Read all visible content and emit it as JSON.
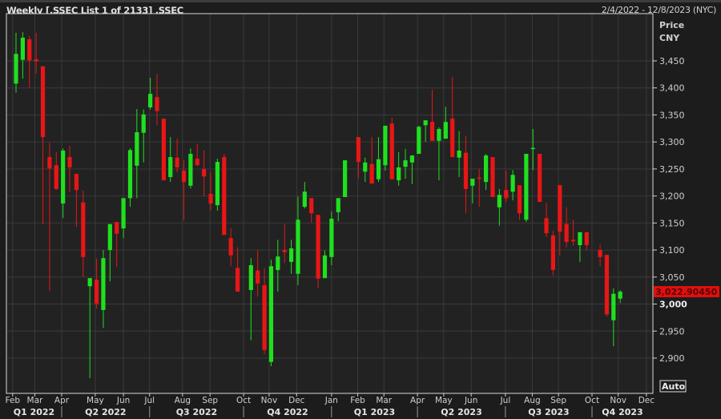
{
  "header": {
    "title": "Weekly [.SSEC List 1 of 2133] .SSEC",
    "range": "2/4/2022 - 12/8/2023 (NYC)"
  },
  "axis": {
    "unit_line1": "Price",
    "unit_line2": "CNY",
    "auto_label": "Auto",
    "last_price_label": "3,022.90450"
  },
  "colors": {
    "up": "#1fe01f",
    "down": "#e81616",
    "grid": "#3a3a3a",
    "plot_bg": "#222222",
    "last_price_bg": "#e01010"
  },
  "chart_data": {
    "type": "candlestick",
    "title": "Weekly .SSEC",
    "ylabel": "Price CNY",
    "ylim": [
      2880,
      3510
    ],
    "xlim": [
      -1.5,
      95
    ],
    "last_price": 3022.9045,
    "yticks": [
      2900,
      2950,
      3000,
      3050,
      3100,
      3150,
      3200,
      3250,
      3300,
      3350,
      3400,
      3450
    ],
    "ytick_labels": [
      "2,900",
      "2,950",
      "3,000",
      "3,050",
      "3,100",
      "3,150",
      "3,200",
      "3,250",
      "3,300",
      "3,350",
      "3,400",
      "3,450"
    ],
    "months": [
      {
        "label": "Feb",
        "w": -0.5
      },
      {
        "label": "Mar",
        "w": 2.8
      },
      {
        "label": "Apr",
        "w": 6.8
      },
      {
        "label": "May",
        "w": 11.8
      },
      {
        "label": "Jun",
        "w": 16
      },
      {
        "label": "Jul",
        "w": 19.9
      },
      {
        "label": "Aug",
        "w": 24.8
      },
      {
        "label": "Sep",
        "w": 28.9
      },
      {
        "label": "Oct",
        "w": 33.9
      },
      {
        "label": "Nov",
        "w": 37.7
      },
      {
        "label": "Dec",
        "w": 41.8
      },
      {
        "label": "Jan",
        "w": 47
      },
      {
        "label": "Feb",
        "w": 50.9
      },
      {
        "label": "Mar",
        "w": 54.8
      },
      {
        "label": "Apr",
        "w": 59.8
      },
      {
        "label": "May",
        "w": 63.7
      },
      {
        "label": "Jun",
        "w": 67.8
      },
      {
        "label": "Jul",
        "w": 72.9
      },
      {
        "label": "Aug",
        "w": 76.9
      },
      {
        "label": "Sep",
        "w": 80.8
      },
      {
        "label": "Oct",
        "w": 85.8
      },
      {
        "label": "Nov",
        "w": 89.7
      },
      {
        "label": "Dec",
        "w": 93.9
      }
    ],
    "quarters": [
      {
        "label": "Q1 2022",
        "from": -1.5,
        "to": 6.8
      },
      {
        "label": "Q2 2022",
        "from": 6.8,
        "to": 19.9
      },
      {
        "label": "Q3 2022",
        "from": 19.9,
        "to": 33.9
      },
      {
        "label": "Q4 2022",
        "from": 33.9,
        "to": 47
      },
      {
        "label": "Q1 2023",
        "from": 47,
        "to": 59.8
      },
      {
        "label": "Q2 2023",
        "from": 59.8,
        "to": 72.9
      },
      {
        "label": "Q3 2023",
        "from": 72.9,
        "to": 85.8
      },
      {
        "label": "Q4 2023",
        "from": 85.8,
        "to": 95
      }
    ],
    "candle_fields": [
      "open",
      "high",
      "low",
      "close"
    ],
    "candles": [
      [
        3408,
        3502,
        3391,
        3463
      ],
      [
        3452,
        3503,
        3417,
        3493
      ],
      [
        3490,
        3496,
        3401,
        3451
      ],
      [
        3453,
        3502,
        3426,
        3449
      ],
      [
        3440,
        3440,
        3148,
        3309
      ],
      [
        3272,
        3299,
        3024,
        3251
      ],
      [
        3257,
        3281,
        3211,
        3213
      ],
      [
        3186,
        3288,
        3159,
        3284
      ],
      [
        3272,
        3293,
        3208,
        3253
      ],
      [
        3241,
        3241,
        3143,
        3211
      ],
      [
        3188,
        3210,
        3050,
        3087
      ],
      [
        3033,
        3048,
        2863,
        3048
      ],
      [
        3045,
        3084,
        2992,
        3001
      ],
      [
        2989,
        3100,
        2956,
        3085
      ],
      [
        3100,
        3148,
        3042,
        3148
      ],
      [
        3152,
        3152,
        3069,
        3130
      ],
      [
        3140,
        3196,
        3122,
        3196
      ],
      [
        3196,
        3288,
        3180,
        3285
      ],
      [
        3256,
        3361,
        3196,
        3318
      ],
      [
        3317,
        3360,
        3262,
        3351
      ],
      [
        3364,
        3419,
        3360,
        3389
      ],
      [
        3383,
        3426,
        3331,
        3357
      ],
      [
        3343,
        3343,
        3229,
        3229
      ],
      [
        3235,
        3309,
        3226,
        3272
      ],
      [
        3271,
        3306,
        3244,
        3253
      ],
      [
        3247,
        3266,
        3155,
        3226
      ],
      [
        3219,
        3288,
        3214,
        3278
      ],
      [
        3269,
        3297,
        3255,
        3257
      ],
      [
        3250,
        3285,
        3199,
        3236
      ],
      [
        3204,
        3244,
        3173,
        3186
      ],
      [
        3183,
        3269,
        3173,
        3263
      ],
      [
        3272,
        3278,
        3128,
        3128
      ],
      [
        3122,
        3140,
        3070,
        3090
      ],
      [
        3067,
        3105,
        3023,
        3023
      ],
      null,
      [
        3026,
        3085,
        2933,
        3072
      ],
      [
        3062,
        3100,
        3014,
        3038
      ],
      [
        3035,
        3066,
        2907,
        2915
      ],
      [
        2893,
        3082,
        2885,
        3070
      ],
      [
        3063,
        3119,
        3023,
        3088
      ],
      [
        3100,
        3148,
        3076,
        3096
      ],
      [
        3078,
        3119,
        3056,
        3103
      ],
      [
        3056,
        3199,
        3035,
        3156
      ],
      [
        3180,
        3226,
        3177,
        3208
      ],
      [
        3196,
        3196,
        3151,
        3168
      ],
      [
        3165,
        3165,
        3030,
        3047
      ],
      [
        3048,
        3099,
        3048,
        3090
      ],
      [
        3087,
        3171,
        3072,
        3158
      ],
      [
        3170,
        3196,
        3153,
        3196
      ],
      [
        3198,
        3266,
        3198,
        3266
      ],
      null,
      [
        3309,
        3309,
        3233,
        3263
      ],
      [
        3245,
        3271,
        3226,
        3262
      ],
      [
        3259,
        3309,
        3223,
        3223
      ],
      [
        3231,
        3309,
        3226,
        3268
      ],
      [
        3257,
        3330,
        3247,
        3330
      ],
      [
        3334,
        3345,
        3231,
        3231
      ],
      [
        3229,
        3281,
        3219,
        3253
      ],
      [
        3254,
        3287,
        3232,
        3266
      ],
      [
        3262,
        3275,
        3222,
        3275
      ],
      [
        3278,
        3330,
        3278,
        3328
      ],
      [
        3331,
        3340,
        3300,
        3340
      ],
      [
        3337,
        3397,
        3302,
        3302
      ],
      [
        3302,
        3327,
        3229,
        3324
      ],
      [
        3306,
        3365,
        3306,
        3337
      ],
      [
        3343,
        3420,
        3272,
        3272
      ],
      [
        3271,
        3320,
        3235,
        3284
      ],
      [
        3280,
        3311,
        3168,
        3213
      ],
      [
        3219,
        3232,
        3186,
        3232
      ],
      [
        3234,
        3250,
        3180,
        3232
      ],
      [
        3226,
        3278,
        3211,
        3275
      ],
      [
        3272,
        3272,
        3198,
        3198
      ],
      [
        3179,
        3213,
        3145,
        3202
      ],
      [
        3211,
        3247,
        3189,
        3196
      ],
      [
        3208,
        3248,
        3192,
        3239
      ],
      [
        3220,
        3220,
        3156,
        3168
      ],
      [
        3156,
        3278,
        3152,
        3278
      ],
      [
        3287,
        3324,
        3248,
        3289
      ],
      [
        3278,
        3278,
        3189,
        3189
      ],
      [
        3159,
        3187,
        3124,
        3131
      ],
      [
        3127,
        3136,
        3053,
        3063
      ],
      [
        3220,
        3220,
        3090,
        3134
      ],
      [
        3148,
        3179,
        3105,
        3115
      ],
      [
        3119,
        3156,
        3108,
        3116
      ],
      [
        3109,
        3133,
        3078,
        3133
      ],
      [
        3133,
        3133,
        3100,
        3109
      ],
      null,
      [
        3100,
        3110,
        3070,
        3087
      ],
      [
        3091,
        3091,
        2977,
        2981
      ],
      [
        2970,
        3029,
        2922,
        3019
      ],
      [
        3010,
        3026,
        3002,
        3023
      ]
    ]
  }
}
